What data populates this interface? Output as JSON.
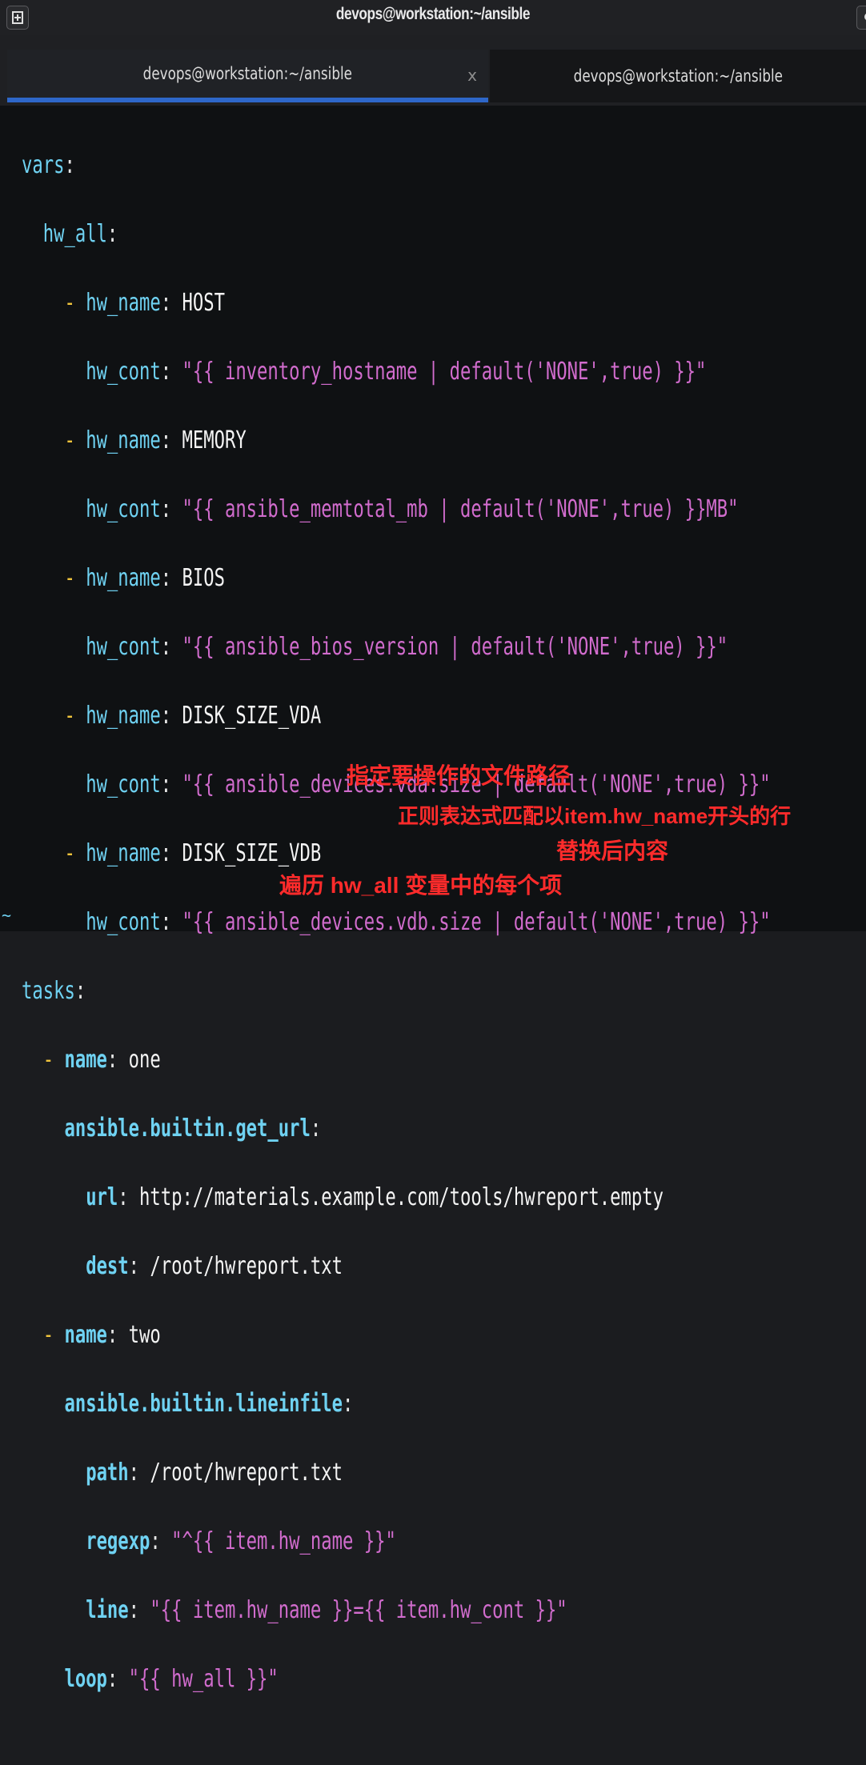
{
  "window": {
    "title": "devops@workstation:~/ansible"
  },
  "tabs": [
    {
      "label": "devops@workstation:~/ansible",
      "close": "x"
    },
    {
      "label": "devops@workstation:~/ansible"
    }
  ],
  "code": {
    "l1": "vars",
    "l2": "hw_all",
    "hw": [
      {
        "name": "HOST",
        "cont": "\"{{ inventory_hostname | default('NONE',true) }}\""
      },
      {
        "name": "MEMORY",
        "cont": "\"{{ ansible_memtotal_mb | default('NONE',true) }}MB\""
      },
      {
        "name": "BIOS",
        "cont": "\"{{ ansible_bios_version | default('NONE',true) }}\""
      },
      {
        "name": "DISK_SIZE_VDA",
        "cont": "\"{{ ansible_devices.vda.size | default('NONE',true) }}\""
      },
      {
        "name": "DISK_SIZE_VDB",
        "cont": "\"{{ ansible_devices.vdb.size | default('NONE',true) }}\""
      }
    ],
    "tasks": "tasks",
    "task1_name": "one",
    "get_url": "ansible.builtin.get_url",
    "url_value": "http://materials.example.com/tools/hwreport.empty",
    "dest_value": "/root/hwreport.txt",
    "task2_name": "two",
    "lineinfile": "ansible.builtin.lineinfile",
    "path_value": "/root/hwreport.txt",
    "regexp_value": "\"^{{ item.hw_name }}\"",
    "line_value": "\"{{ item.hw_name }}={{ item.hw_cont }}\"",
    "loop_value": "\"{{ hw_all }}\"",
    "tilde": "~"
  },
  "annotations": {
    "path": "指定要操作的文件路径",
    "regexp": "正则表达式匹配以item.hw_name开头的行",
    "line": "替换后内容",
    "loop": "遍历 hw_all 变量中的每个项"
  },
  "colors": {
    "key": "#6fd2f2",
    "string": "#d16ccd",
    "dash": "#f0c43c",
    "annotation": "#ff2b2b",
    "tab_accent": "#2e67c9"
  }
}
